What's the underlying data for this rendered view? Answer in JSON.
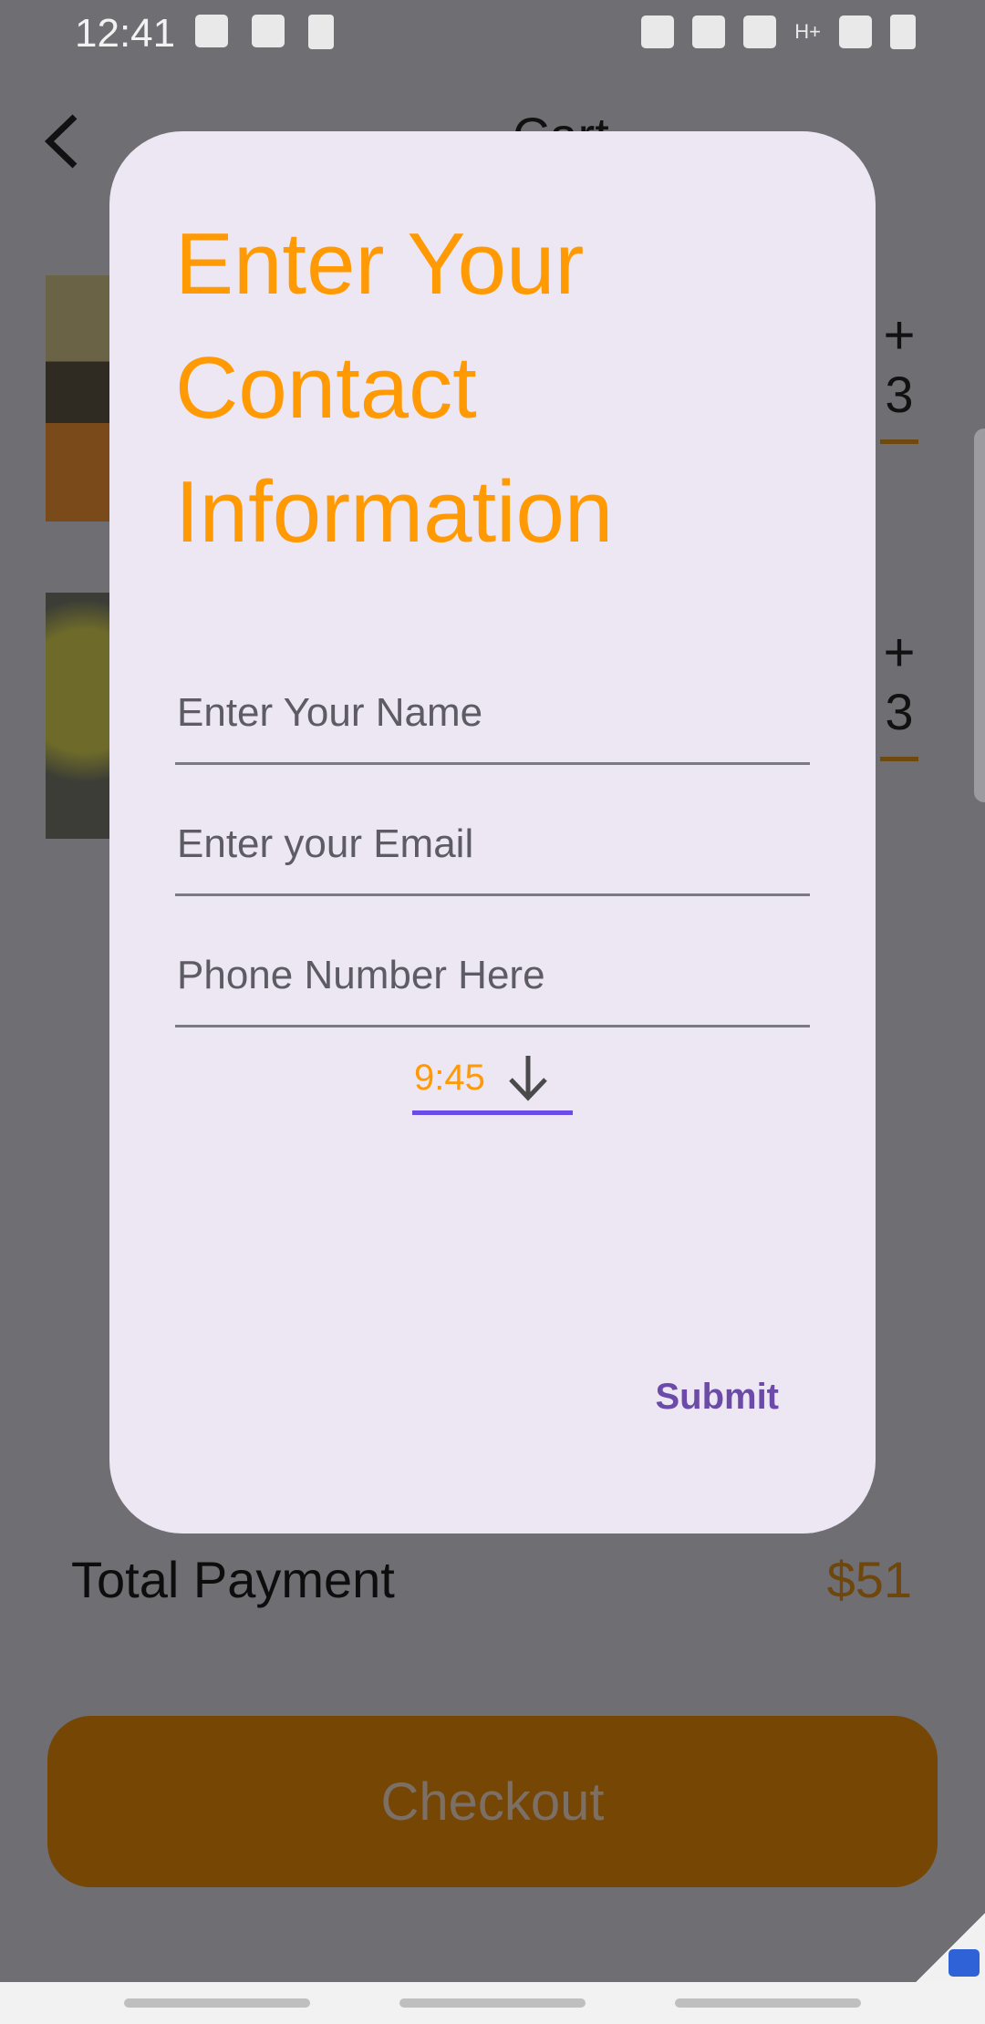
{
  "status_bar": {
    "time": "12:41",
    "battery_label": "100",
    "network_label": "H+"
  },
  "background": {
    "title": "Cart",
    "items": [
      {
        "quantity": "3",
        "plus_label": "+"
      },
      {
        "quantity": "3",
        "plus_label": "+"
      }
    ],
    "total_label": "Total Payment",
    "total_value": "$51",
    "checkout_label": "Checkout"
  },
  "dialog": {
    "title": "Enter Your Contact Information",
    "name_placeholder": "Enter Your Name",
    "email_placeholder": "Enter your Email",
    "phone_placeholder": "Phone Number Here",
    "time_value": "9:45",
    "submit_label": "Submit"
  },
  "colors": {
    "accent_orange": "#ff9a05",
    "dialog_bg": "#ede7f4",
    "purple": "#6b4de6",
    "checkout_bg": "#754604"
  },
  "icons": [
    "back-arrow-icon",
    "arrow-down-icon",
    "plus-icon",
    "minus-icon",
    "lock-icon"
  ]
}
